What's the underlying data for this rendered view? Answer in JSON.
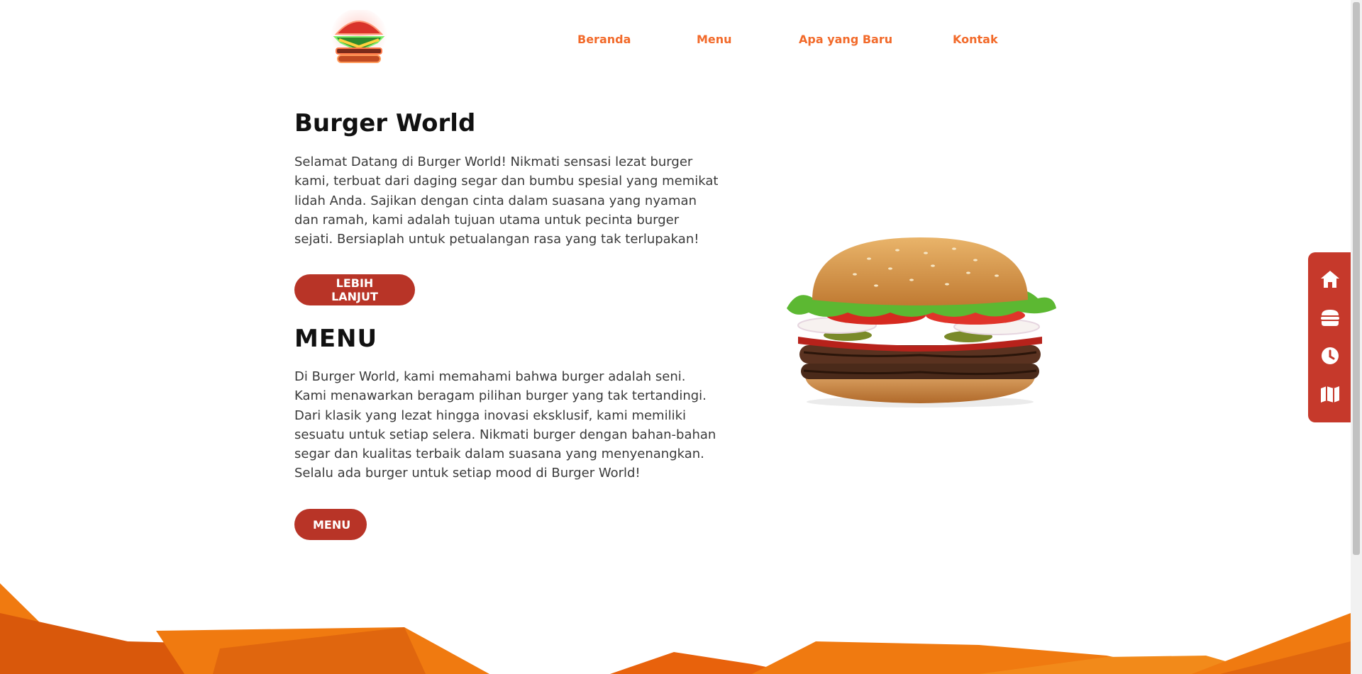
{
  "brand": {
    "logo_icon": "neon-burger-logo"
  },
  "nav": {
    "items": [
      "Beranda",
      "Menu",
      "Apa yang Baru",
      "Kontak"
    ]
  },
  "hero": {
    "title": "Burger World",
    "text": "Selamat Datang di Burger World! Nikmati sensasi lezat burger kami, terbuat dari daging segar dan bumbu spesial yang memikat lidah Anda. Sajikan dengan cinta dalam suasana yang nyaman dan ramah, kami adalah tujuan utama untuk pecinta burger sejati. Bersiaplah untuk petualangan rasa yang tak terlupakan!",
    "button": "LEBIH LANJUT"
  },
  "menu_section": {
    "title": "MENU",
    "text": "Di Burger World, kami memahami bahwa burger adalah seni. Kami menawarkan beragam pilihan burger yang tak tertandingi. Dari klasik yang lezat hingga inovasi eksklusif, kami memiliki sesuatu untuk setiap selera. Nikmati burger dengan bahan-bahan segar dan kualitas terbaik dalam suasana yang menyenangkan. Selalu ada burger untuk setiap mood di Burger World!",
    "button": "MENU"
  },
  "side_nav": {
    "icons": [
      "home-icon",
      "burger-icon",
      "clock-icon",
      "map-icon"
    ]
  },
  "colors": {
    "accent_orange": "#f26a2a",
    "button_red": "#b83427",
    "side_panel_red": "#c6392b",
    "wave_orange": "#f07a10"
  }
}
